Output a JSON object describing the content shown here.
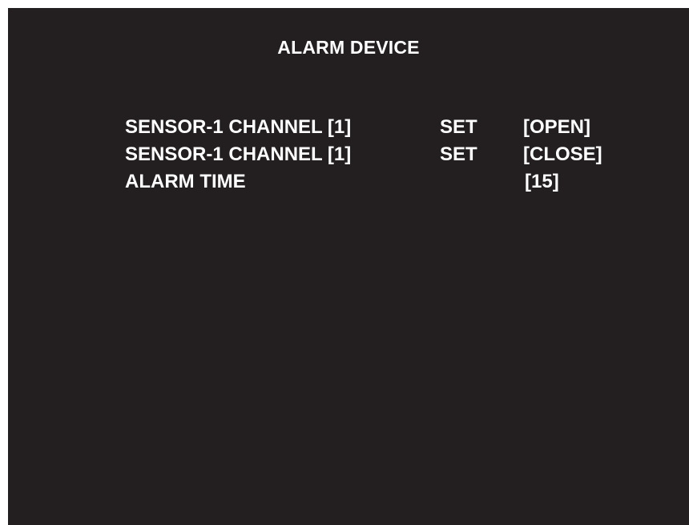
{
  "title": "ALARM DEVICE",
  "rows": [
    {
      "label": "SENSOR-1 CHANNEL [1]",
      "action": "SET",
      "value": "[OPEN]"
    },
    {
      "label": "SENSOR-1 CHANNEL [1]",
      "action": "SET",
      "value": "[CLOSE]"
    },
    {
      "label": "ALARM TIME",
      "action": "",
      "value": "[15]"
    }
  ],
  "colors": {
    "background": "#231f20",
    "text": "#ffffff",
    "frame": "#ffffff"
  }
}
